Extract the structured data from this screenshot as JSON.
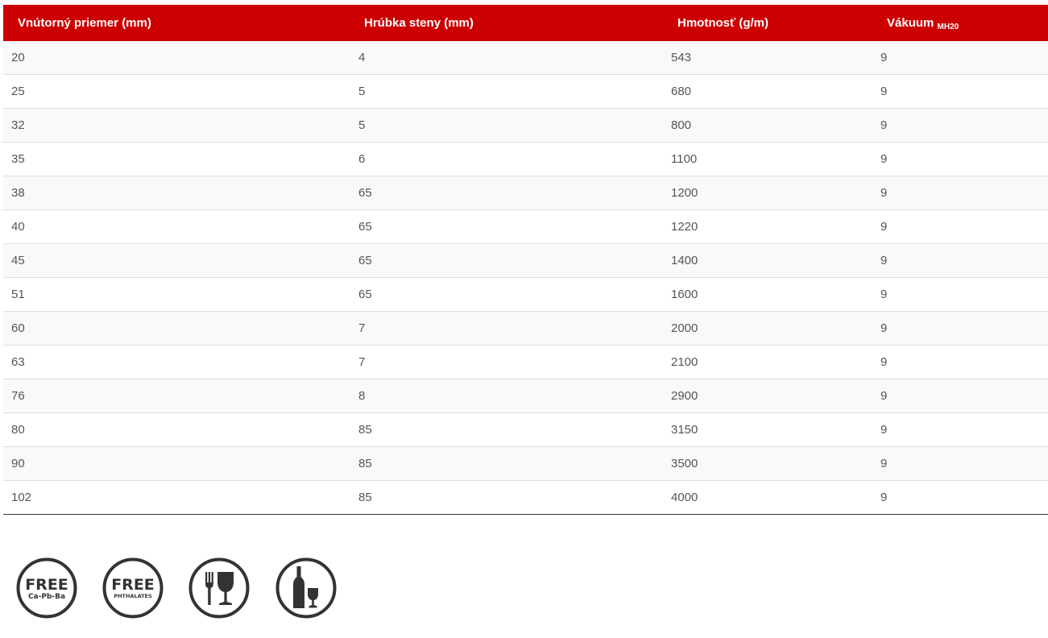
{
  "table": {
    "headers": [
      "Vnútorný priemer (mm)",
      "Hrúbka steny (mm)",
      "Hmotnosť (g/m)",
      "Vákuum"
    ],
    "vacuum_unit": "MH20",
    "rows": [
      [
        "20",
        "4",
        "543",
        "9"
      ],
      [
        "25",
        "5",
        "680",
        "9"
      ],
      [
        "32",
        "5",
        "800",
        "9"
      ],
      [
        "35",
        "6",
        "1100",
        "9"
      ],
      [
        "38",
        "65",
        "1200",
        "9"
      ],
      [
        "40",
        "65",
        "1220",
        "9"
      ],
      [
        "45",
        "65",
        "1400",
        "9"
      ],
      [
        "51",
        "65",
        "1600",
        "9"
      ],
      [
        "60",
        "7",
        "2000",
        "9"
      ],
      [
        "63",
        "7",
        "2100",
        "9"
      ],
      [
        "76",
        "8",
        "2900",
        "9"
      ],
      [
        "80",
        "85",
        "3150",
        "9"
      ],
      [
        "90",
        "85",
        "3500",
        "9"
      ],
      [
        "102",
        "85",
        "4000",
        "9"
      ]
    ]
  },
  "badges": {
    "free_ca": {
      "title": "FREE",
      "subtitle": "Ca-Pb-Ba"
    },
    "free_phthalates": {
      "title": "FREE",
      "subtitle": "PHTHALATES"
    },
    "food_icon": "fork-and-glass-icon",
    "drink_icon": "bottle-and-glass-icon"
  },
  "colors": {
    "header_bg": "#cc0000",
    "header_text": "#ffffff",
    "cell_text": "#555555",
    "badge": "#333333"
  }
}
